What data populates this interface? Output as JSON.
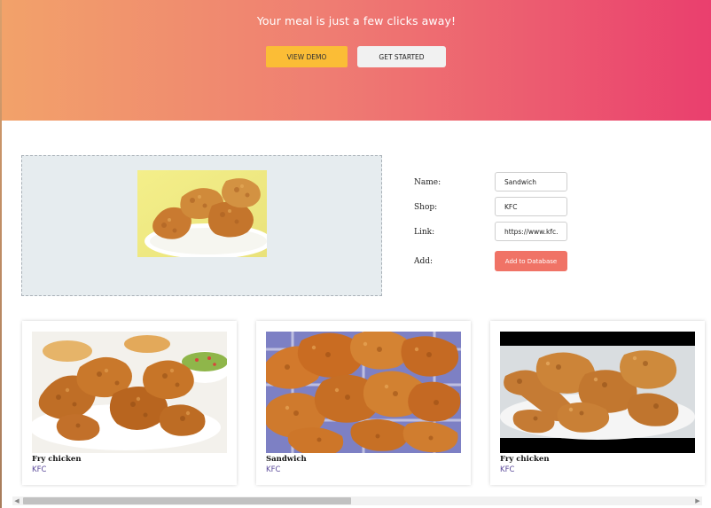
{
  "hero": {
    "title": "Your meal is just a few clicks away!",
    "view_demo_label": "VIEW DEMO",
    "get_started_label": "GET STARTED"
  },
  "form": {
    "name_label": "Name:",
    "name_value": "Sandwich",
    "shop_label": "Shop:",
    "shop_value": "KFC",
    "link_label": "Link:",
    "link_value": "https://www.kfc.ca",
    "add_label": "Add:",
    "add_button_label": "Add to Database"
  },
  "cards": [
    {
      "title": "Fry chicken",
      "shop": "KFC",
      "image": "fried-chicken-plate"
    },
    {
      "title": "Sandwich",
      "shop": "KFC",
      "image": "fried-chicken-basket"
    },
    {
      "title": "Fry chicken",
      "shop": "KFC",
      "image": "fried-chicken-drumsticks"
    }
  ],
  "colors": {
    "hero_gradient_start": "#f2a26a",
    "hero_gradient_end": "#ea3f6e",
    "view_demo_bg": "#fbbd36",
    "add_button_bg": "#f07366",
    "shop_text": "#5b4a9a"
  },
  "scrollbar": {
    "left_arrow": "◀",
    "right_arrow": "▶"
  }
}
